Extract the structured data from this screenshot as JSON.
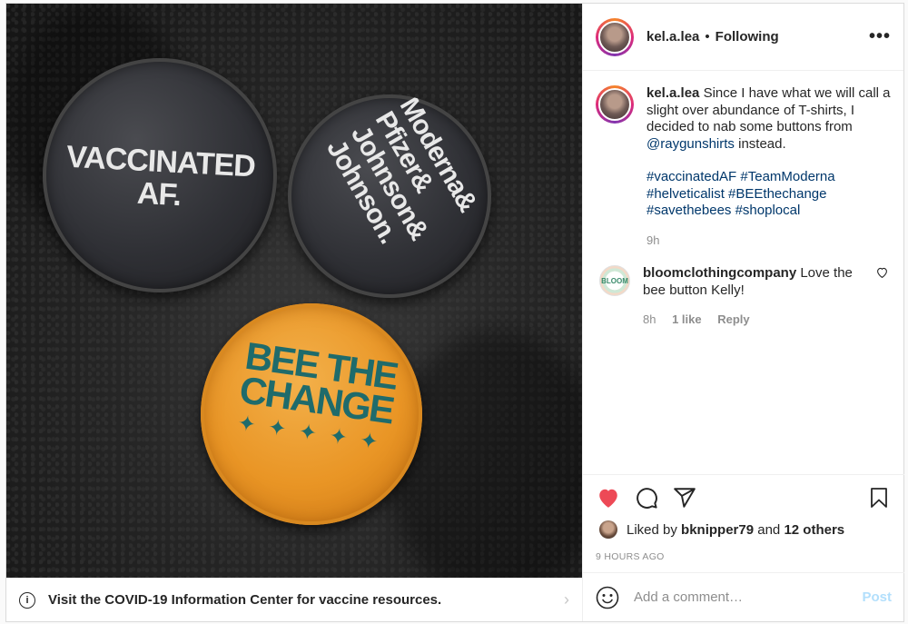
{
  "post": {
    "username": "kel.a.lea",
    "separator": "•",
    "follow_status": "Following",
    "more_glyph": "•••",
    "caption": {
      "username": "kel.a.lea",
      "text": "Since I have what we will call a slight over abundance of T-shirts, I decided to nab some buttons from",
      "mention": "@raygunshirts",
      "text_after": "instead.",
      "hashtags": "#vaccinatedAF #TeamModerna #helveticalist #BEEthechange #savethebees #shoplocal",
      "time": "9h"
    },
    "comment": {
      "username": "bloomclothingcompany",
      "text": "Love the bee button Kelly!",
      "time": "8h",
      "likes": "1 like",
      "reply": "Reply",
      "avatar_text": "BLOOM"
    },
    "likes": {
      "prefix": "Liked by",
      "user": "bknipper79",
      "and": "and",
      "others": "12 others"
    },
    "timeago": "9 HOURS AGO",
    "add_comment": {
      "placeholder": "Add a comment…",
      "post_label": "Post"
    },
    "liked": true
  },
  "media": {
    "pin1_text": "VACCINATED\nAF.",
    "pin2_text": "Moderna&\nPfizer&\nJohnson&\nJohnson.",
    "pin3_text": "BEE THE\nCHANGE",
    "bee_glyph": "✦"
  },
  "covid_bar": {
    "info_glyph": "i",
    "text": "Visit the COVID-19 Information Center for vaccine resources.",
    "chevron": "›"
  },
  "colors": {
    "heart": "#ed4956",
    "link": "#00376b",
    "muted": "#8e8e8e",
    "post_disabled": "#b2dffc"
  }
}
